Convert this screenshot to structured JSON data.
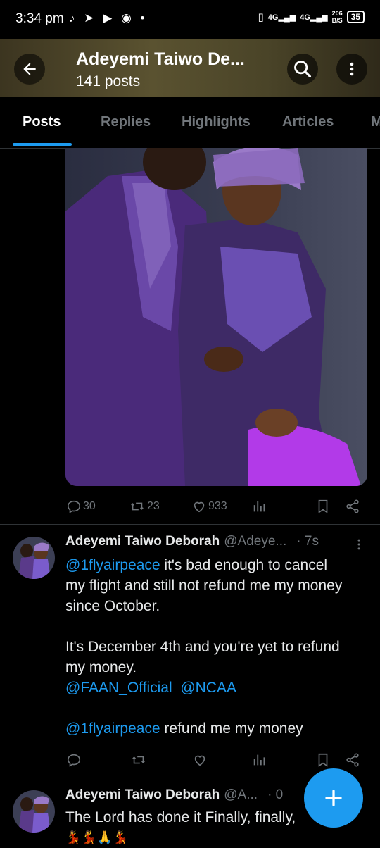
{
  "status_bar": {
    "time": "3:34 pm",
    "left_icons": "♪ ➤ ▶ ◉ •",
    "net_speed_top": "206",
    "net_speed_bottom": "B/S",
    "network_label": "4G",
    "battery": "35"
  },
  "header": {
    "title": "Adeyemi Taiwo De...",
    "subtitle": "141 posts"
  },
  "tabs": [
    "Posts",
    "Replies",
    "Highlights",
    "Articles",
    "M"
  ],
  "post1": {
    "replies": "30",
    "reposts": "23",
    "likes": "933"
  },
  "tweet1": {
    "name": "Adeyemi Taiwo Deborah",
    "handle": "@Adeye...",
    "time": "· 7s",
    "line1_mention": "@1flyairpeace",
    "line1_rest": " it's bad enough to cancel",
    "line2": "my flight and still not refund me my money",
    "line3": "since October.",
    "line4": "It's December 4th and you're yet to refund",
    "line5": "my money.",
    "mention_a": "@FAAN_Official",
    "mention_b": "@NCAA",
    "last_mention": "@1flyairpeace",
    "last_rest": " refund me my money"
  },
  "tweet2": {
    "name": "Adeyemi Taiwo Deborah",
    "handle": "@A...",
    "time": "· 0",
    "text": "The Lord has done it Finally, finally,",
    "emojis": "💃💃🙏💃"
  },
  "icons": [
    "back-arrow-icon",
    "search-icon",
    "more-icon",
    "reply-icon",
    "repost-icon",
    "like-icon",
    "views-icon",
    "bookmark-icon",
    "share-icon",
    "plus-icon"
  ],
  "colors": {
    "accent": "#1d9bf0",
    "muted": "#71767b"
  }
}
